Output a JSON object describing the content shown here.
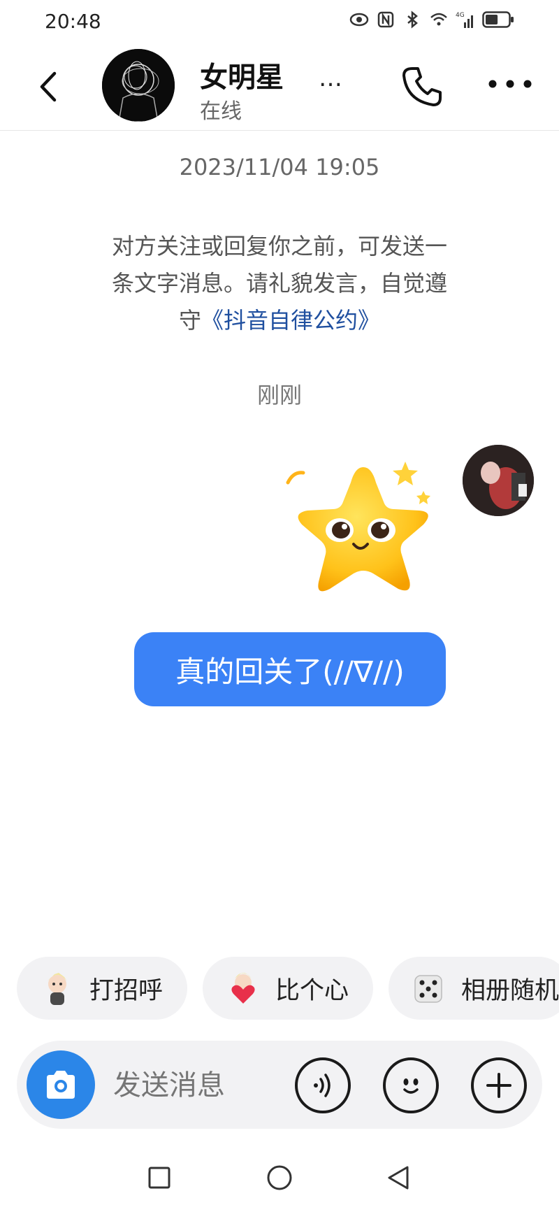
{
  "status_bar": {
    "time": "20:48",
    "battery_level": 0.55
  },
  "header": {
    "name": "女明星",
    "status": "在线",
    "name_more": "…"
  },
  "chat": {
    "timestamp": "2023/11/04 19:05",
    "notice_text": "对方关注或回复你之前，可发送一条文字消息。请礼貌发言，自觉遵守",
    "notice_link": "《抖音自律公约》",
    "just_now": "刚刚",
    "message_text": "真的回关了(//∇//)"
  },
  "quick_replies": [
    {
      "label": "打招呼",
      "icon": "cartoon-wave-icon"
    },
    {
      "label": "比个心",
      "icon": "cartoon-heart-icon"
    },
    {
      "label": "相册随机",
      "icon": "dice-icon"
    }
  ],
  "input": {
    "placeholder": "发送消息"
  },
  "colors": {
    "accent": "#3b82f6",
    "link": "#1f4f9f",
    "camera": "#2b86e8"
  }
}
